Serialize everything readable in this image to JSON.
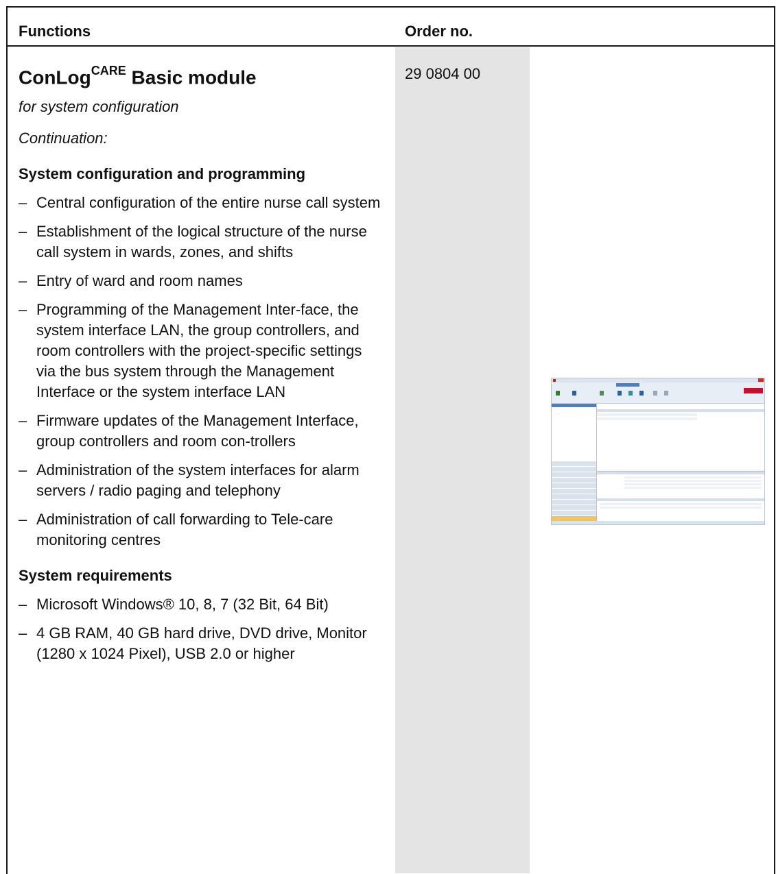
{
  "header": {
    "functions": "Functions",
    "order": "Order no."
  },
  "product": {
    "name_main": "ConLog",
    "name_sup": "CARE",
    "name_tail": " Basic module",
    "subtitle": "for system configuration",
    "continuation": "Continuation:",
    "order_no": "29 0804 00"
  },
  "sections": [
    {
      "heading": "System configuration and programming",
      "items": [
        "Central configuration of the entire nurse call system",
        "Establishment of the logical structure of the nurse call system in wards, zones, and shifts",
        "Entry of ward and room names",
        "Programming of the Management Inter-face, the system interface LAN, the group controllers, and room controllers with the project-specific settings via the bus system through the Management Interface or the system interface LAN",
        "Firmware updates of the Management Interface, group controllers and room con-trollers",
        "Administration of the system interfaces for alarm servers / radio paging and telephony",
        "Administration of call forwarding to Tele-care monitoring centres"
      ]
    },
    {
      "heading": "System requirements",
      "items": [
        "Microsoft Windows® 10, 8, 7 (32 Bit, 64 Bit)",
        "4 GB RAM, 40 GB hard drive, DVD drive, Monitor (1280 x 1024 Pixel), USB 2.0 or higher"
      ]
    }
  ],
  "thumbnail": {
    "brand_color": "#c8102e",
    "accent_color": "#4a7fc1"
  }
}
